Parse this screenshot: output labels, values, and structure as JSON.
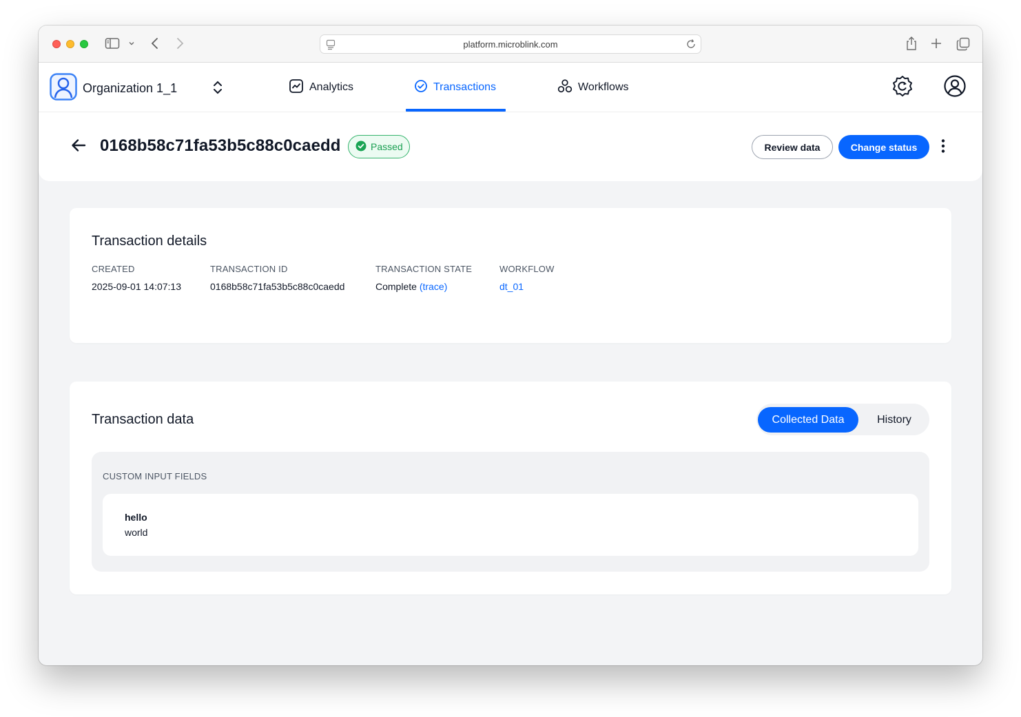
{
  "browser": {
    "url": "platform.microblink.com"
  },
  "header": {
    "org_name": "Organization 1_1",
    "nav": [
      {
        "label": "Analytics",
        "icon": "analytics-icon"
      },
      {
        "label": "Transactions",
        "icon": "check-circle-icon",
        "active": true
      },
      {
        "label": "Workflows",
        "icon": "workflows-icon"
      }
    ]
  },
  "titlebar": {
    "transaction_id": "0168b58c71fa53b5c88c0caedd",
    "status": "Passed",
    "review_label": "Review data",
    "change_status_label": "Change status"
  },
  "details": {
    "title": "Transaction details",
    "created_label": "CREATED",
    "created_value": "2025-09-01 14:07:13",
    "id_label": "TRANSACTION ID",
    "id_value": "0168b58c71fa53b5c88c0caedd",
    "state_label": "TRANSACTION STATE",
    "state_value": "Complete",
    "state_link": "(trace)",
    "workflow_label": "WORKFLOW",
    "workflow_value": "dt_01"
  },
  "data_card": {
    "title": "Transaction data",
    "tab_active": "Collected Data",
    "tab_inactive": "History",
    "section_label": "CUSTOM INPUT FIELDS",
    "field_key": "hello",
    "field_value": "world"
  },
  "colors": {
    "accent": "#0866ff",
    "success": "#1a9f52",
    "background": "#f3f4f6"
  }
}
